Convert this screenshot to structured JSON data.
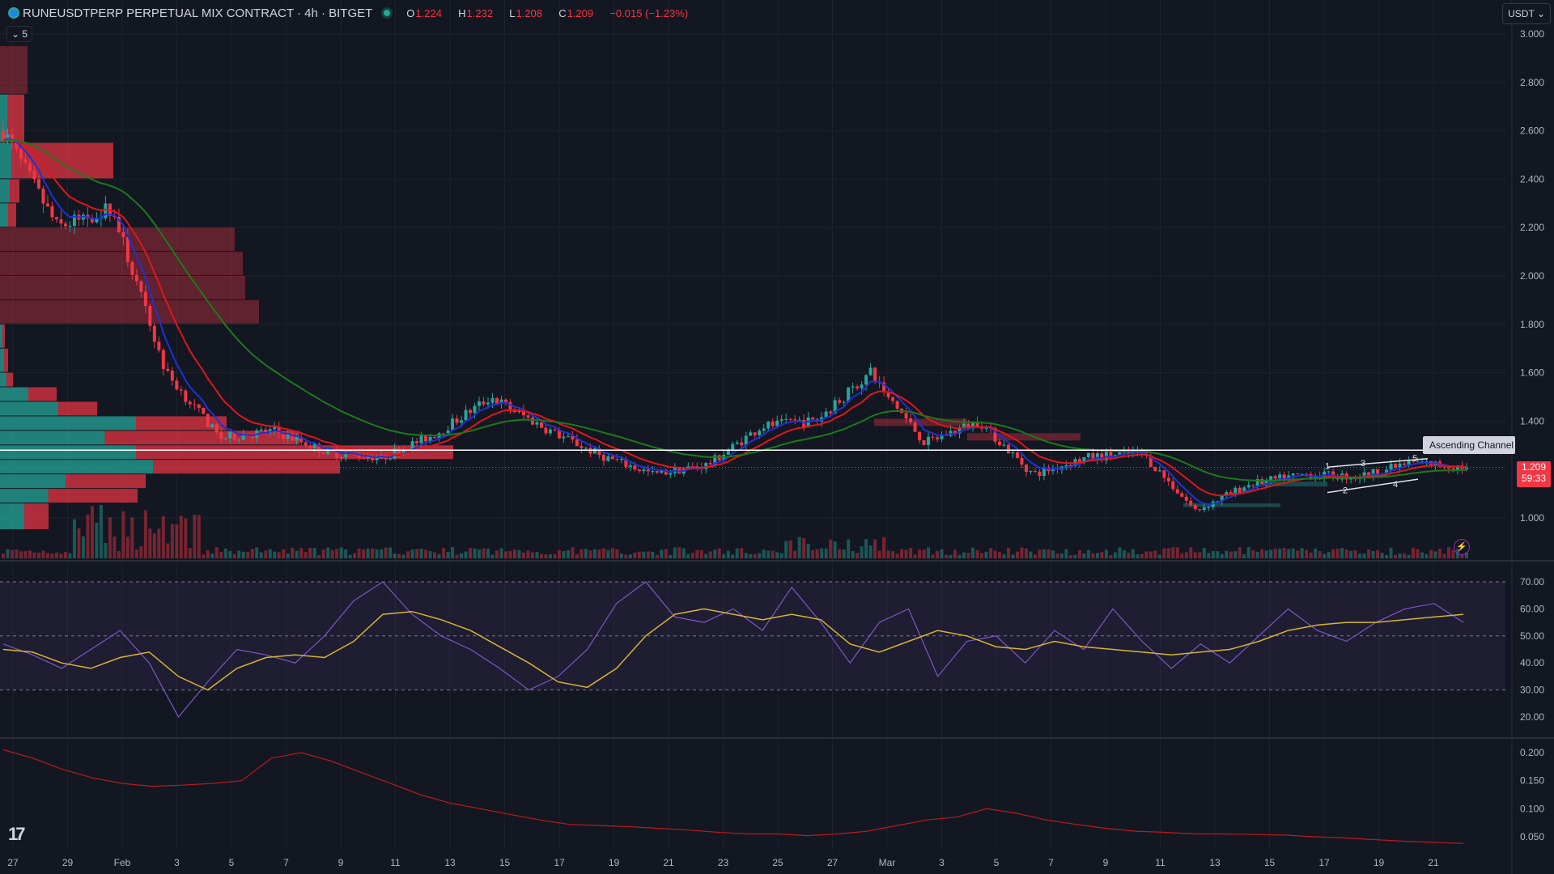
{
  "header": {
    "symbol_title": "RUNEUSDTPERP PERPETUAL MIX CONTRACT · 4h · BITGET",
    "open_label": "O",
    "open": "1.224",
    "high_label": "H",
    "high": "1.232",
    "low_label": "L",
    "low": "1.208",
    "close_label": "C",
    "close": "1.209",
    "change": "−0.015 (−1.23%)"
  },
  "toolbar": {
    "indicators_collapsed_count": "5",
    "currency_button": "USDT"
  },
  "price_tag": {
    "price": "1.209",
    "countdown": "59:33"
  },
  "annotation": {
    "ascending_channel": "Ascending Channel",
    "wave_labels": [
      "1",
      "2",
      "3",
      "4",
      "5"
    ]
  },
  "icons": {
    "logo": "tradingview-logo-icon",
    "live": "live-status-icon",
    "lightning": "lightning-icon",
    "chevron": "chevron-down-icon"
  },
  "colors": {
    "background": "#131722",
    "up": "#26a69a",
    "down": "#f23645",
    "ema_fast": "#2130d6",
    "ema_mid": "#e0161b",
    "ema_slow": "#1b7a1b",
    "rsi": "#7e57c2",
    "rsi_ma": "#d8b52f",
    "lower": "#b71c1c"
  },
  "chart_data": [
    {
      "type": "candlestick",
      "title": "RUNEUSDTPERP PERPETUAL MIX CONTRACT · 4h · BITGET",
      "x_ticks": [
        "27",
        "29",
        "Feb",
        "3",
        "5",
        "7",
        "9",
        "11",
        "13",
        "15",
        "17",
        "19",
        "21",
        "23",
        "25",
        "27",
        "Mar",
        "3",
        "5",
        "7",
        "9",
        "11",
        "13",
        "15",
        "17",
        "19",
        "21"
      ],
      "y_ticks": [
        "3.000",
        "2.800",
        "2.600",
        "2.400",
        "2.200",
        "2.000",
        "1.800",
        "1.600",
        "1.400",
        "1.200",
        "1.000"
      ],
      "ylim": [
        0.85,
        3.05
      ],
      "key_prices": [
        {
          "date": "Jan 27",
          "price": 2.6
        },
        {
          "date": "Jan 29",
          "price": 2.2
        },
        {
          "date": "Jan 31",
          "price": 2.28
        },
        {
          "date": "Feb 2",
          "price": 1.6
        },
        {
          "date": "Feb 3",
          "price": 1.33
        },
        {
          "date": "Feb 5",
          "price": 1.36
        },
        {
          "date": "Feb 7",
          "price": 1.27
        },
        {
          "date": "Feb 9",
          "price": 1.25
        },
        {
          "date": "Feb 11",
          "price": 1.35
        },
        {
          "date": "Feb 13",
          "price": 1.5
        },
        {
          "date": "Feb 15",
          "price": 1.37
        },
        {
          "date": "Feb 17",
          "price": 1.26
        },
        {
          "date": "Feb 19",
          "price": 1.18
        },
        {
          "date": "Feb 21",
          "price": 1.22
        },
        {
          "date": "Feb 23",
          "price": 1.38
        },
        {
          "date": "Feb 25",
          "price": 1.4
        },
        {
          "date": "Feb 27",
          "price": 1.6
        },
        {
          "date": "Feb 28",
          "price": 1.31
        },
        {
          "date": "Mar 3",
          "price": 1.4
        },
        {
          "date": "Mar 5",
          "price": 1.18
        },
        {
          "date": "Mar 7",
          "price": 1.25
        },
        {
          "date": "Mar 9",
          "price": 1.27
        },
        {
          "date": "Mar 11",
          "price": 1.03
        },
        {
          "date": "Mar 13",
          "price": 1.14
        },
        {
          "date": "Mar 15",
          "price": 1.18
        },
        {
          "date": "Mar 17",
          "price": 1.17
        },
        {
          "date": "Mar 19",
          "price": 1.23
        },
        {
          "date": "Mar 21",
          "price": 1.209
        }
      ],
      "last_price": 1.209,
      "horizontal_line": 1.28,
      "moving_averages": [
        "fast (blue)",
        "mid (red)",
        "slow (green)"
      ],
      "volume_profile": "left-side, teal up / pink down",
      "grid": true
    },
    {
      "type": "line",
      "y_ticks": [
        "70.00",
        "60.00",
        "50.00",
        "40.00",
        "30.00",
        "20.00"
      ],
      "ylim": [
        15,
        75
      ],
      "bands": [
        30,
        50,
        70
      ],
      "series": [
        {
          "values": [
            47,
            43,
            38,
            45,
            52,
            40,
            20,
            33,
            45,
            43,
            40,
            50,
            63,
            70,
            58,
            50,
            45,
            38,
            30,
            35,
            45,
            62,
            70,
            57,
            55,
            60,
            52,
            68,
            55,
            40,
            55,
            60,
            35,
            48,
            50,
            40,
            52,
            45,
            60,
            48,
            38,
            47,
            40,
            50,
            60,
            52,
            48,
            55,
            60,
            62,
            55
          ]
        },
        {
          "values": [
            45,
            44,
            40,
            38,
            42,
            44,
            35,
            30,
            38,
            42,
            43,
            42,
            48,
            58,
            59,
            56,
            52,
            46,
            40,
            33,
            31,
            38,
            50,
            58,
            60,
            58,
            56,
            58,
            56,
            47,
            44,
            48,
            52,
            50,
            46,
            45,
            48,
            46,
            45,
            44,
            43,
            44,
            45,
            48,
            52,
            54,
            55,
            55,
            56,
            57,
            58
          ]
        }
      ],
      "grid": true
    },
    {
      "type": "line",
      "y_ticks": [
        "0.200",
        "0.150",
        "0.100",
        "0.050"
      ],
      "ylim": [
        0.03,
        0.22
      ],
      "series": [
        {
          "values": [
            0.205,
            0.19,
            0.17,
            0.155,
            0.145,
            0.14,
            0.142,
            0.145,
            0.15,
            0.19,
            0.2,
            0.185,
            0.165,
            0.145,
            0.125,
            0.11,
            0.1,
            0.09,
            0.08,
            0.072,
            0.07,
            0.068,
            0.065,
            0.062,
            0.058,
            0.055,
            0.055,
            0.052,
            0.055,
            0.06,
            0.07,
            0.08,
            0.085,
            0.1,
            0.092,
            0.08,
            0.072,
            0.065,
            0.06,
            0.058,
            0.055,
            0.055,
            0.054,
            0.053,
            0.05,
            0.048,
            0.045,
            0.042,
            0.04,
            0.038
          ]
        }
      ]
    }
  ]
}
